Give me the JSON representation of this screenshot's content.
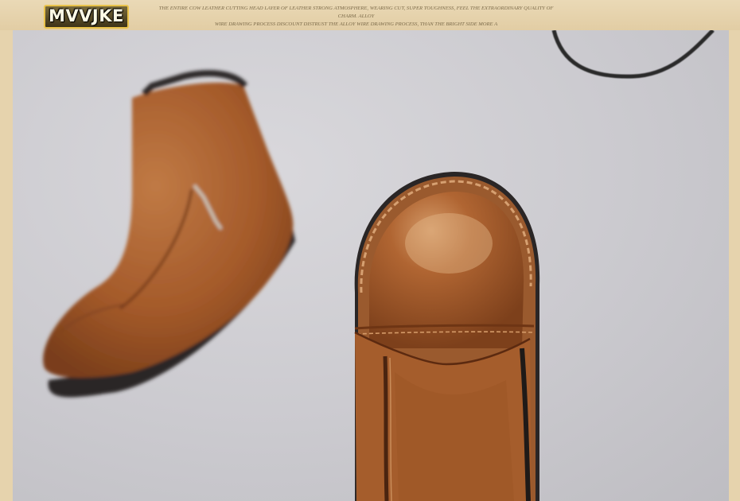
{
  "brand": {
    "logo_text": "MVVJKE",
    "tagline_line1": "THE ENTIRE COW LEATHER CUTTING HEAD LAYER OF LEATHER STRONG ATMOSPHERE, WEARING CUT, SUPER TOUGHNESS, FEEL THE EXTRAORDINARY QUALITY OF CHARM. ALLOY",
    "tagline_line2": "WIRE DRAWING PROCESS DISCOUNT DISTRUST THE ALLOY WIRE DRAWING PROCESS, THAN THE BRIGHT SIDE MORE A"
  },
  "colors": {
    "frame": "#e6d3ad",
    "backdrop": "#cbcacf",
    "leather": "#a85a2a",
    "sole": "#2a2626"
  },
  "image": {
    "subject": "brown leather ankle boots with side zipper"
  }
}
